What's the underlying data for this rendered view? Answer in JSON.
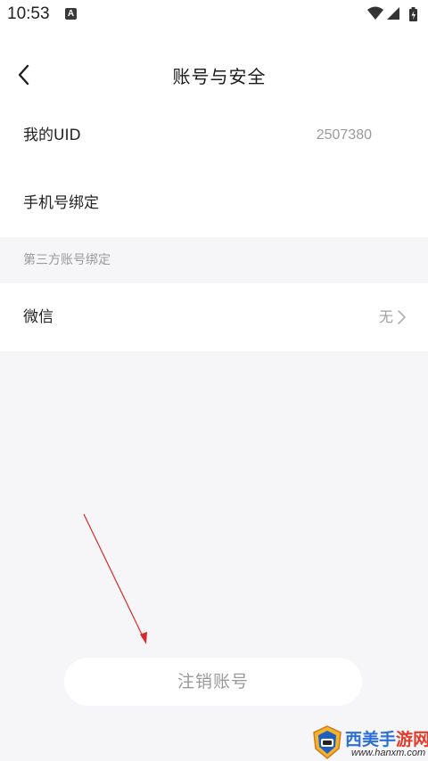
{
  "status_bar": {
    "time": "10:53",
    "notification_glyph": "A",
    "icons": [
      "wifi-icon",
      "signal-icon",
      "battery-icon"
    ]
  },
  "header": {
    "title": "账号与安全",
    "back_icon": "chevron-left-icon"
  },
  "rows": [
    {
      "label": "我的UID",
      "value": "2507380"
    },
    {
      "label": "手机号绑定",
      "value": ""
    }
  ],
  "third_party": {
    "section_label": "第三方账号绑定",
    "wechat": {
      "label": "微信",
      "value": "无",
      "icon": "chevron-right-icon"
    }
  },
  "logout_button": {
    "label": "注销账号"
  },
  "annotation": {
    "color": "#d42b2b",
    "icon": "arrow-pointer-icon"
  },
  "watermark": {
    "title_chars": [
      {
        "char": "西",
        "color": "#2c6fd6"
      },
      {
        "char": "美",
        "color": "#2c6fd6"
      },
      {
        "char": "手",
        "color": "#2c6fd6"
      },
      {
        "char": "游",
        "color": "#e23b2b"
      },
      {
        "char": "网",
        "color": "#e23b2b"
      }
    ],
    "url": "www.hanxm.com"
  }
}
